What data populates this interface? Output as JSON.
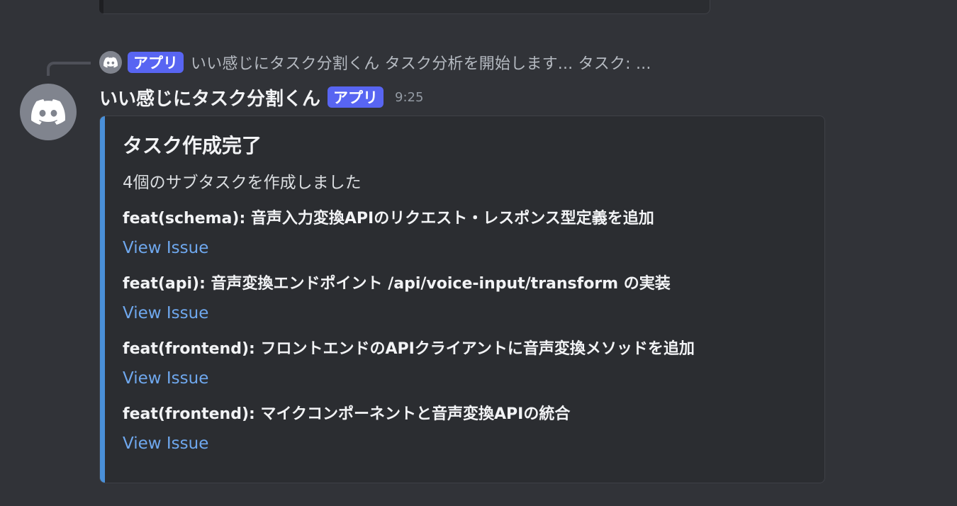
{
  "colors": {
    "background": "#313338",
    "embed_background": "#2b2d31",
    "embed_accent": "#4a90d9",
    "app_badge": "#5865f2",
    "link": "#6fa8ee"
  },
  "reply": {
    "icon": "discord-icon",
    "badge": "アプリ",
    "preview": "いい感じにタスク分割くん タスク分析を開始します... タスク: ..."
  },
  "message": {
    "avatar_icon": "discord-icon",
    "username": "いい感じにタスク分割くん",
    "badge": "アプリ",
    "timestamp": "9:25"
  },
  "embed": {
    "title": "タスク作成完了",
    "description": "4個のサブタスクを作成しました",
    "tasks": [
      {
        "title": "feat(schema): 音声入力変換APIのリクエスト・レスポンス型定義を追加",
        "link": "View Issue"
      },
      {
        "title": "feat(api): 音声変換エンドポイント /api/voice-input/transform の実装",
        "link": "View Issue"
      },
      {
        "title": "feat(frontend): フロントエンドのAPIクライアントに音声変換メソッドを追加",
        "link": "View Issue"
      },
      {
        "title": "feat(frontend): マイクコンポーネントと音声変換APIの統合",
        "link": "View Issue"
      }
    ]
  }
}
